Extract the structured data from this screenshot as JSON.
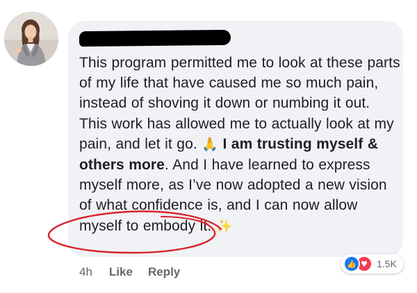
{
  "comment": {
    "author_name_redacted": true,
    "text_lines": {
      "p1": "This program permitted me to look at these parts of my life that have caused me so much pain, instead of shoving it down or numbing it out. This work has allowed me to actually look at my pain, and let it go.",
      "p2_bold": "I am trusting myself & others more",
      "p3": ". And I have learned to express myself more, as I’ve now adopted a new vision of what confidence is, and I can now allow myself to embody it."
    },
    "emoji_pray": "🙏",
    "emoji_sparkles": "✨"
  },
  "actions": {
    "timestamp": "4h",
    "like_label": "Like",
    "reply_label": "Reply"
  },
  "reactions": {
    "count": "1.5K",
    "types": [
      "like-icon",
      "love-icon"
    ]
  },
  "colors": {
    "bubble_bg": "#f0f2f5",
    "text": "#1c1e21",
    "meta_text": "#65676b",
    "like_blue": "#1877f2",
    "love_red": "#f33e58",
    "annotation_red": "#d8232a"
  }
}
